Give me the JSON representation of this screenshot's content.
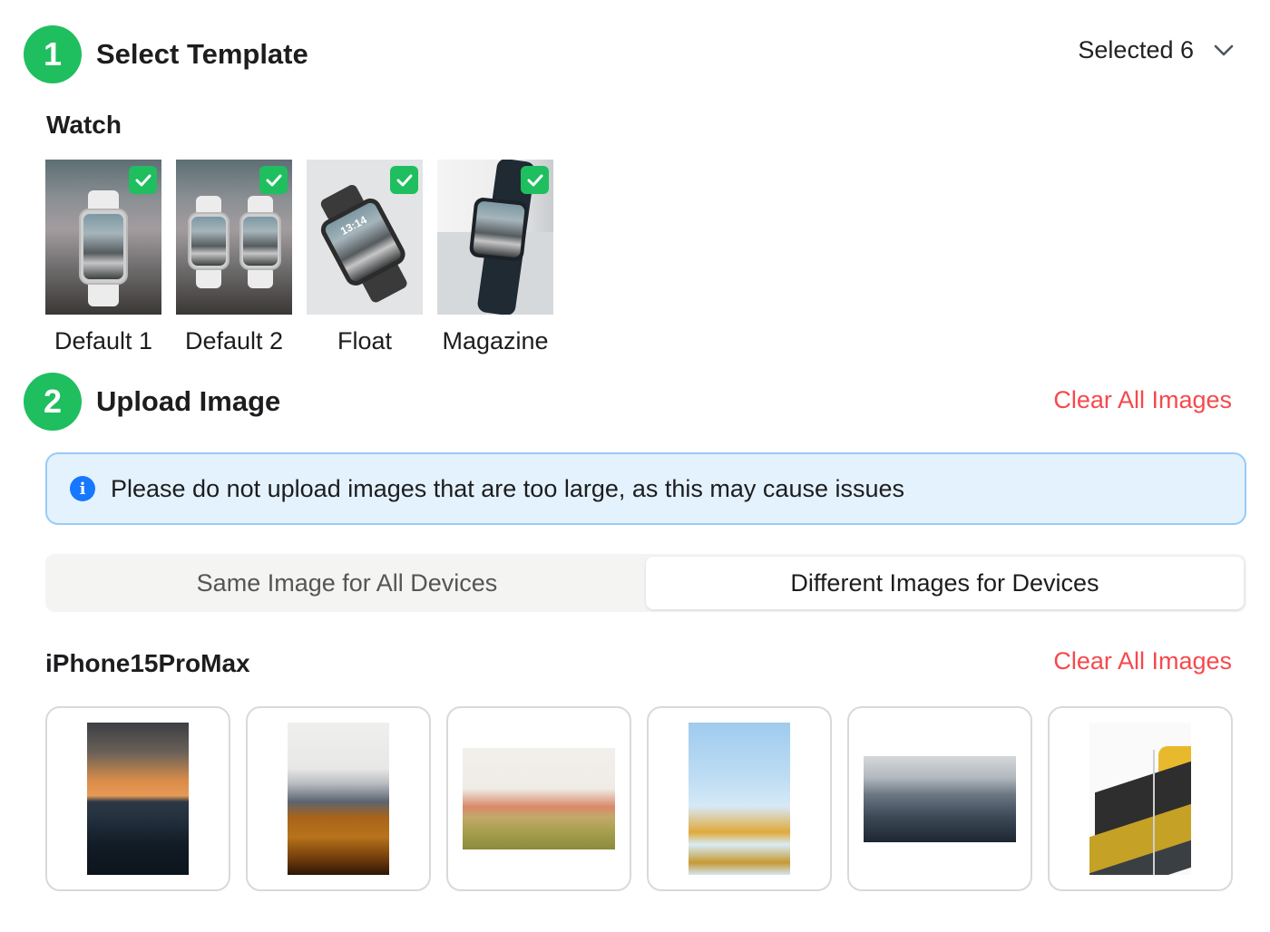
{
  "step1": {
    "number": "1",
    "title": "Select Template",
    "selected_label": "Selected 6"
  },
  "watch": {
    "label": "Watch",
    "templates": [
      {
        "name": "Default 1",
        "checked": true
      },
      {
        "name": "Default 2",
        "checked": true
      },
      {
        "name": "Float",
        "checked": true
      },
      {
        "name": "Magazine",
        "checked": true
      }
    ],
    "watch_time": "13:14"
  },
  "step2": {
    "number": "2",
    "title": "Upload Image",
    "clear_label": "Clear All Images"
  },
  "info": {
    "icon": "i",
    "text": "Please do not upload images that are too large, as this may cause issues"
  },
  "mode_tabs": [
    {
      "label": "Same Image for All Devices",
      "active": false
    },
    {
      "label": "Different Images for Devices",
      "active": true
    }
  ],
  "device": {
    "name": "iPhone15ProMax",
    "clear_label": "Clear All Images",
    "images": [
      {
        "subject": "sunset over mountain ridges"
      },
      {
        "subject": "snowy mountains with autumn forest"
      },
      {
        "subject": "poppy flower meadow"
      },
      {
        "subject": "yellow flowers against blue sky"
      },
      {
        "subject": "misty forest"
      },
      {
        "subject": "yellow and black lattice building"
      }
    ]
  },
  "colors": {
    "accent_green": "#1fbe5f",
    "danger_red": "#f5494d",
    "info_blue": "#1677ff"
  }
}
